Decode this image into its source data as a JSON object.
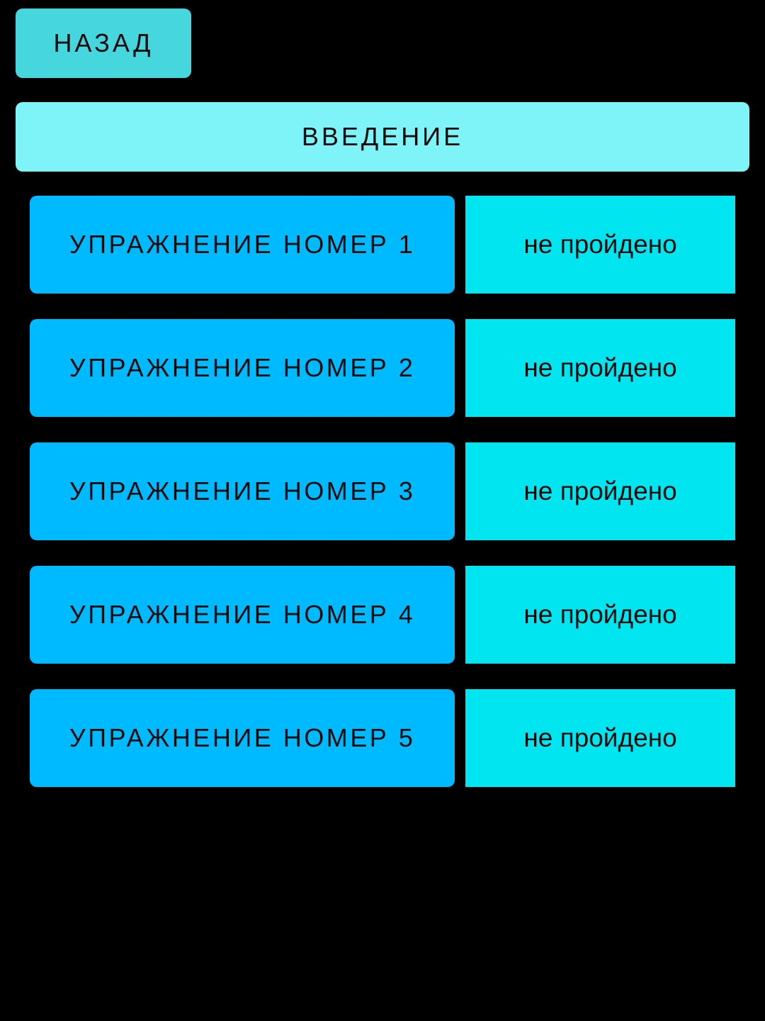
{
  "header": {
    "back_label": "НАЗАД",
    "intro_label": "ВВЕДЕНИЕ"
  },
  "exercises": [
    {
      "label": "УПРАЖНЕНИЕ НОМЕР 1",
      "status": "не пройдено"
    },
    {
      "label": "УПРАЖНЕНИЕ НОМЕР 2",
      "status": "не пройдено"
    },
    {
      "label": "УПРАЖНЕНИЕ НОМЕР 3",
      "status": "не пройдено"
    },
    {
      "label": "УПРАЖНЕНИЕ НОМЕР 4",
      "status": "не пройдено"
    },
    {
      "label": "УПРАЖНЕНИЕ НОМЕР 5",
      "status": "не пройдено"
    }
  ],
  "colors": {
    "background": "#000000",
    "back_button": "#45d6de",
    "intro_button": "#7ef4f8",
    "exercise_button": "#00baff",
    "status_cell": "#00e5ef"
  }
}
